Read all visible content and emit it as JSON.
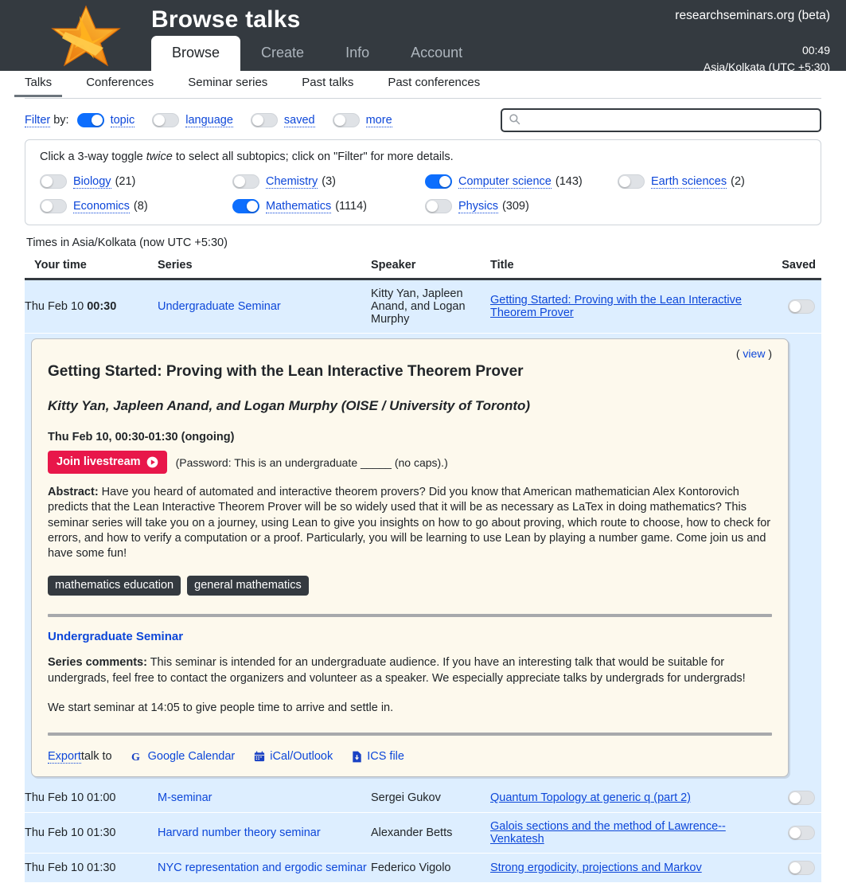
{
  "header": {
    "title": "Browse talks",
    "site": "researchseminars.org (beta)",
    "clock": "00:49",
    "timezone": "Asia/Kolkata (UTC +5:30)",
    "logo_icon": "star-logo",
    "tabs": [
      {
        "label": "Browse",
        "active": true
      },
      {
        "label": "Create",
        "active": false
      },
      {
        "label": "Info",
        "active": false
      },
      {
        "label": "Account",
        "active": false
      }
    ]
  },
  "subnav": [
    {
      "label": "Talks",
      "active": true
    },
    {
      "label": "Conferences",
      "active": false
    },
    {
      "label": "Seminar series",
      "active": false
    },
    {
      "label": "Past talks",
      "active": false
    },
    {
      "label": "Past conferences",
      "active": false
    }
  ],
  "filter": {
    "filter_label": "Filter",
    "by_label": "by:",
    "toggles": [
      {
        "label": "topic",
        "on": true
      },
      {
        "label": "language",
        "on": false
      },
      {
        "label": "saved",
        "on": false
      },
      {
        "label": "more",
        "on": false
      }
    ]
  },
  "search": {
    "value": "",
    "placeholder": "",
    "icon": "search-icon"
  },
  "topic_panel": {
    "hint_pre": "Click a 3-way toggle ",
    "hint_em": "twice",
    "hint_post": " to select all subtopics; click on \"Filter\" for more details.",
    "topics": [
      {
        "label": "Biology",
        "count": "(21)",
        "on": false
      },
      {
        "label": "Chemistry",
        "count": "(3)",
        "on": false
      },
      {
        "label": "Computer science",
        "count": "(143)",
        "on": true
      },
      {
        "label": "Earth sciences",
        "count": "(2)",
        "on": false
      },
      {
        "label": "Economics",
        "count": "(8)",
        "on": false
      },
      {
        "label": "Mathematics",
        "count": "(1114)",
        "on": true
      },
      {
        "label": "Physics",
        "count": "(309)",
        "on": false
      }
    ]
  },
  "times_note": "Times in Asia/Kolkata (now UTC +5:30)",
  "table": {
    "columns": [
      "Your time",
      "Series",
      "Speaker",
      "Title",
      "Saved"
    ],
    "rows": [
      {
        "time_date": "Thu Feb 10 ",
        "time_clock": "00:30",
        "series": "Undergraduate Seminar",
        "speaker": "Kitty Yan, Japleen Anand, and Logan Murphy",
        "title": "Getting Started: Proving with the Lean Interactive Theorem Prover",
        "saved": false
      },
      {
        "time_date": "Thu Feb 10 01:00",
        "time_clock": "",
        "series": "M-seminar",
        "speaker": "Sergei Gukov",
        "title": "Quantum Topology at generic q (part 2)",
        "saved": false
      },
      {
        "time_date": "Thu Feb 10 01:30",
        "time_clock": "",
        "series": "Harvard number theory seminar",
        "speaker": "Alexander Betts",
        "title": "Galois sections and the method of Lawrence--Venkatesh",
        "saved": false
      },
      {
        "time_date": "Thu Feb 10 01:30",
        "time_clock": "",
        "series": "NYC representation and ergodic seminar",
        "speaker": "Federico Vigolo",
        "title": "Strong ergodicity, projections and Markov",
        "saved": false
      }
    ]
  },
  "detail": {
    "view_open": "(",
    "view_label": "view",
    "view_close": ")",
    "title": "Getting Started: Proving with the Lean Interactive Theorem Prover",
    "speaker": "Kitty Yan, Japleen Anand, and Logan Murphy (OISE / University of Toronto)",
    "when": "Thu Feb 10, 00:30-01:30 (ongoing)",
    "join_label": "Join livestream",
    "join_icon": "play-circle-icon",
    "password_note": "(Password: This is an undergraduate _____ (no caps).)",
    "abstract_label": "Abstract:",
    "abstract": " Have you heard of automated and interactive theorem provers? Did you know that American mathematician Alex Kontorovich predicts that the Lean Interactive Theorem Prover will be so widely used that it will be as necessary as LaTex in doing mathematics? This seminar series will take you on a journey, using Lean to give you insights on how to go about proving, which route to choose, how to check for errors, and how to verify a computation or a proof. Particularly, you will be learning to use Lean by playing a number game. Come join us and have some fun!",
    "chips": [
      "mathematics education",
      "general mathematics"
    ],
    "series_name": "Undergraduate Seminar",
    "comments_label": "Series comments:",
    "comments": " This seminar is intended for an undergraduate audience. If you have an interesting talk that would be suitable for undergrads, feel free to contact the organizers and volunteer as a speaker. We especially appreciate talks by undergrads for undergrads!",
    "note": "We start seminar at 14:05 to give people time to arrive and settle in.",
    "export_label": "Export",
    "export_text": " talk to",
    "export_links": [
      {
        "label": "Google Calendar",
        "icon": "google-icon"
      },
      {
        "label": "iCal/Outlook",
        "icon": "calendar-icon"
      },
      {
        "label": "ICS file",
        "icon": "file-download-icon"
      }
    ]
  },
  "colors": {
    "header_bg": "#343a40",
    "accent_blue": "#0d6efd",
    "link_blue": "#0d47d9",
    "row_bg": "#ddeeff",
    "panel_bg": "#fdf9ed",
    "join_red": "#e8174a",
    "chip_bg": "#343a40",
    "star_orange": "#f7941e"
  }
}
